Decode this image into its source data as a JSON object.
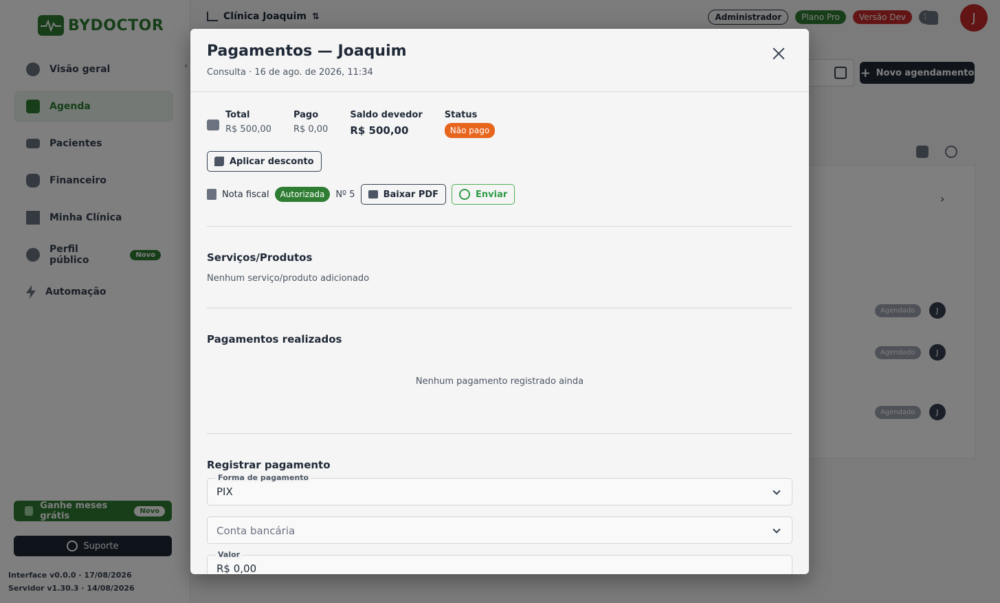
{
  "app": {
    "brand": "BYDOCTOR",
    "clinic_name": "Clínica Joaquim",
    "badges": {
      "admin": "Administrador",
      "plan": "Plano Pro",
      "dev": "Versão Dev"
    },
    "help": "?",
    "avatar_initial": "J",
    "new_appointment": "Novo agendamento",
    "sidebar": {
      "items": [
        {
          "label": "Visão geral",
          "icon": "pie-chart-icon"
        },
        {
          "label": "Agenda",
          "icon": "calendar-icon",
          "active": true
        },
        {
          "label": "Pacientes",
          "icon": "id-card-icon"
        },
        {
          "label": "Financeiro",
          "icon": "money-bag-icon"
        },
        {
          "label": "Minha Clínica",
          "icon": "building-icon"
        },
        {
          "label": "Perfil público",
          "icon": "globe-icon",
          "badge": "Novo"
        },
        {
          "label": "Automação",
          "icon": "lightning-icon"
        }
      ],
      "promo_label": "Ganhe meses grátis",
      "promo_badge": "Novo",
      "support_label": "Suporte",
      "version_interface": "Interface v0.0.0 · 17/08/2026",
      "version_server": "Servidor v1.30.3 · 14/08/2026"
    },
    "bg_rows": [
      {
        "status": "Agendado",
        "initial": "J"
      },
      {
        "status": "Agendado",
        "initial": "J"
      },
      {
        "status": "Agendado",
        "initial": "J"
      }
    ]
  },
  "modal": {
    "title": "Pagamentos — Joaquim",
    "subtitle": "Consulta · 16 de ago. de 2026, 11:34",
    "summary": {
      "total_label": "Total",
      "total_value": "R$ 500,00",
      "paid_label": "Pago",
      "paid_value": "R$ 0,00",
      "balance_label": "Saldo devedor",
      "balance_value": "R$ 500,00",
      "status_label": "Status",
      "status_value": "Não pago"
    },
    "discount_button": "Aplicar desconto",
    "invoice": {
      "label": "Nota fiscal",
      "status": "Autorizada",
      "number": "Nº 5",
      "pdf_button": "Baixar PDF",
      "send_button": "Enviar"
    },
    "services": {
      "title": "Serviços/Produtos",
      "empty": "Nenhum serviço/produto adicionado"
    },
    "payments_done": {
      "title": "Pagamentos realizados",
      "empty": "Nenhum pagamento registrado ainda"
    },
    "register": {
      "title": "Registrar pagamento",
      "method_label": "Forma de pagamento",
      "method_value": "PIX",
      "account_placeholder": "Conta bancária",
      "amount_label": "Valor",
      "amount_value": "R$ 0,00"
    }
  },
  "colors": {
    "brand_green": "#2e7d32",
    "status_orange": "#e8651e",
    "danger_red": "#c62828",
    "whatsapp_green": "#2e9b47"
  }
}
